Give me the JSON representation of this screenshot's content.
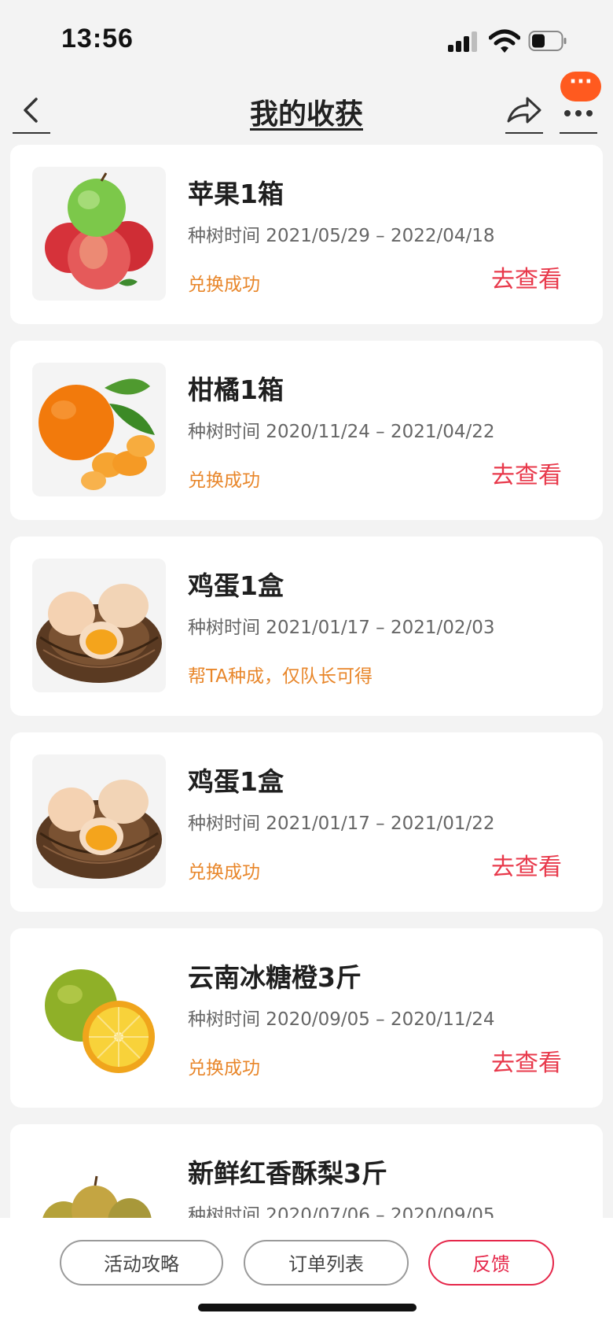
{
  "status_bar": {
    "time": "13:56"
  },
  "nav": {
    "title": "我的收获",
    "more_badge": "···"
  },
  "items": [
    {
      "title": "苹果1箱",
      "date": "种树时间 2021/05/29 – 2022/04/18",
      "status": "兑换成功",
      "action": "去查看",
      "image": "apple"
    },
    {
      "title": "柑橘1箱",
      "date": "种树时间 2020/11/24 – 2021/04/22",
      "status": "兑换成功",
      "action": "去查看",
      "image": "tangerine"
    },
    {
      "title": "鸡蛋1盒",
      "date": "种树时间 2021/01/17 – 2021/02/03",
      "status": "帮TA种成，仅队长可得",
      "action": "",
      "image": "eggs"
    },
    {
      "title": "鸡蛋1盒",
      "date": "种树时间 2021/01/17 – 2021/01/22",
      "status": "兑换成功",
      "action": "去查看",
      "image": "eggs"
    },
    {
      "title": "云南冰糖橙3斤",
      "date": "种树时间 2020/09/05 – 2020/11/24",
      "status": "兑换成功",
      "action": "去查看",
      "image": "orange"
    },
    {
      "title": "新鲜红香酥梨3斤",
      "date": "种树时间 2020/07/06 – 2020/09/05",
      "status": "",
      "action": "",
      "image": "pear"
    }
  ],
  "bottom_bar": {
    "btn1": "活动攻略",
    "btn2": "订单列表",
    "btn3": "反馈"
  },
  "colors": {
    "status": "#e8862a",
    "action": "#e8394b",
    "badge": "#ff5a1f",
    "feedback": "#e5274a"
  }
}
